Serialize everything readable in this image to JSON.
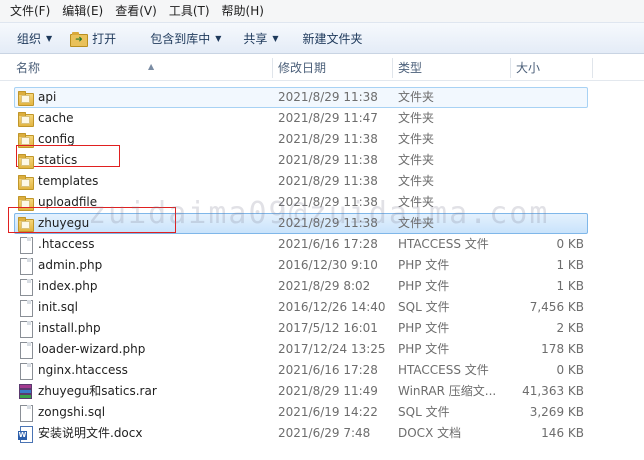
{
  "menubar": [
    {
      "label": "文件(F)"
    },
    {
      "label": "编辑(E)"
    },
    {
      "label": "查看(V)"
    },
    {
      "label": "工具(T)"
    },
    {
      "label": "帮助(H)"
    }
  ],
  "toolbar": {
    "organize": "组织",
    "open": "打开",
    "include_in_library": "包含到库中",
    "share": "共享",
    "new_folder": "新建文件夹"
  },
  "columns": {
    "name": "名称",
    "date": "修改日期",
    "type": "类型",
    "size": "大小"
  },
  "files": [
    {
      "name": "api",
      "date": "2021/8/29 11:38",
      "type": "文件夹",
      "size": "",
      "icon": "folder-icon"
    },
    {
      "name": "cache",
      "date": "2021/8/29 11:47",
      "type": "文件夹",
      "size": "",
      "icon": "folder-icon"
    },
    {
      "name": "config",
      "date": "2021/8/29 11:38",
      "type": "文件夹",
      "size": "",
      "icon": "folder-icon"
    },
    {
      "name": "statics",
      "date": "2021/8/29 11:38",
      "type": "文件夹",
      "size": "",
      "icon": "folder-icon"
    },
    {
      "name": "templates",
      "date": "2021/8/29 11:38",
      "type": "文件夹",
      "size": "",
      "icon": "folder-icon"
    },
    {
      "name": "uploadfile",
      "date": "2021/8/29 11:38",
      "type": "文件夹",
      "size": "",
      "icon": "folder-icon"
    },
    {
      "name": "zhuyegu",
      "date": "2021/8/29 11:38",
      "type": "文件夹",
      "size": "",
      "icon": "folder-icon"
    },
    {
      "name": ".htaccess",
      "date": "2021/6/16 17:28",
      "type": "HTACCESS 文件",
      "size": "0 KB",
      "icon": "document-icon"
    },
    {
      "name": "admin.php",
      "date": "2016/12/30 9:10",
      "type": "PHP 文件",
      "size": "1 KB",
      "icon": "document-icon"
    },
    {
      "name": "index.php",
      "date": "2021/8/29 8:02",
      "type": "PHP 文件",
      "size": "1 KB",
      "icon": "document-icon"
    },
    {
      "name": "init.sql",
      "date": "2016/12/26 14:40",
      "type": "SQL 文件",
      "size": "7,456 KB",
      "icon": "document-icon"
    },
    {
      "name": "install.php",
      "date": "2017/5/12 16:01",
      "type": "PHP 文件",
      "size": "2 KB",
      "icon": "document-icon"
    },
    {
      "name": "loader-wizard.php",
      "date": "2017/12/24 13:25",
      "type": "PHP 文件",
      "size": "178 KB",
      "icon": "document-icon"
    },
    {
      "name": "nginx.htaccess",
      "date": "2021/6/16 17:28",
      "type": "HTACCESS 文件",
      "size": "0 KB",
      "icon": "document-icon"
    },
    {
      "name": "zhuyegu和satics.rar",
      "date": "2021/8/29 11:49",
      "type": "WinRAR 压缩文...",
      "size": "41,363 KB",
      "icon": "winrar-archive-icon"
    },
    {
      "name": "zongshi.sql",
      "date": "2021/6/19 14:22",
      "type": "SQL 文件",
      "size": "3,269 KB",
      "icon": "document-icon"
    },
    {
      "name": "安装说明文件.docx",
      "date": "2021/6/29 7:48",
      "type": "DOCX 文档",
      "size": "146 KB",
      "icon": "word-document-icon"
    }
  ],
  "watermark": "zuidaima09@zuidaima.com",
  "colors": {
    "highlight_border": "#7fb7e9",
    "annotation_red": "#e02020"
  }
}
